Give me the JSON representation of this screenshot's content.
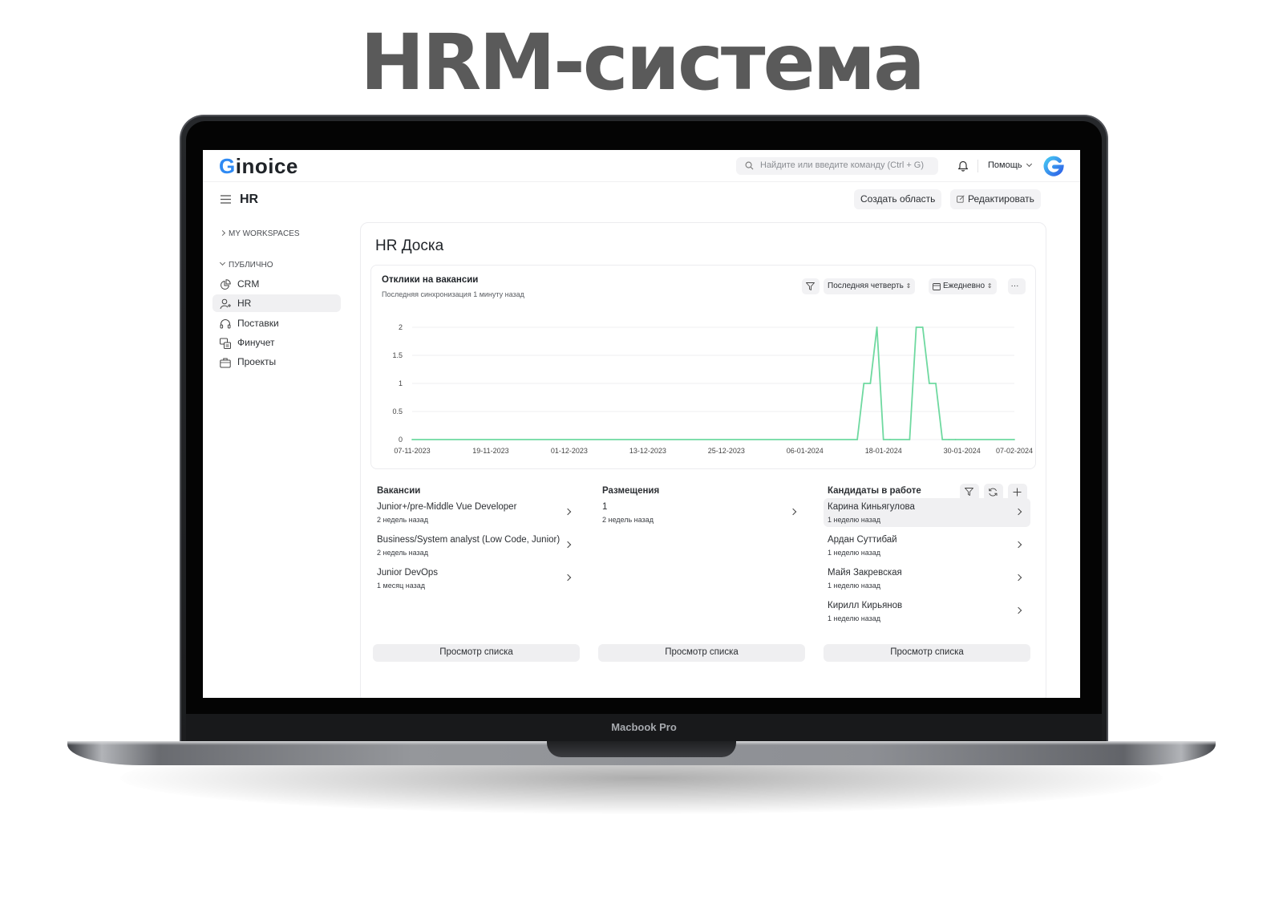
{
  "headline": "HRM-система",
  "device": {
    "brand_label": "Macbook Pro"
  },
  "app": {
    "logo_first": "G",
    "logo_rest": "inoice",
    "search_placeholder": "Найдите или введите команду (Ctrl + G)",
    "help_label": "Помощь",
    "accent_color": "#2f8af3"
  },
  "page": {
    "title": "HR",
    "create_area_label": "Создать область",
    "edit_label": "Редактировать"
  },
  "sidebar": {
    "my_workspaces": "MY WORKSPACES",
    "public_section": "ПУБЛИЧНО",
    "items": [
      {
        "label": "CRM",
        "icon": "chart-pie-icon",
        "active": false
      },
      {
        "label": "HR",
        "icon": "user-add-icon",
        "active": true
      },
      {
        "label": "Поставки",
        "icon": "headset-icon",
        "active": false
      },
      {
        "label": "Финучет",
        "icon": "money-icon",
        "active": false
      },
      {
        "label": "Проекты",
        "icon": "briefcase-icon",
        "active": false
      }
    ]
  },
  "board": {
    "title": "HR Доска",
    "chart_title": "Отклики на вакансии",
    "chart_subtitle": "Последняя синхронизация 1 минуту назад",
    "period_select": "Последняя четверть",
    "interval_select": "Ежедневно",
    "more_label": "···"
  },
  "chart_data": {
    "type": "line",
    "title": "Отклики на вакансии",
    "xlabel": "",
    "ylabel": "",
    "ylim": [
      0,
      2
    ],
    "y_ticks": [
      "0",
      "0.5",
      "1",
      "1.5",
      "2"
    ],
    "x_ticks": [
      "07-11-2023",
      "19-11-2023",
      "01-12-2023",
      "13-12-2023",
      "25-12-2023",
      "06-01-2024",
      "18-01-2024",
      "30-01-2024",
      "07-02-2024"
    ],
    "grid": true,
    "line_color": "#6fd9a0",
    "series": [
      {
        "x": [
          "07-11-2023",
          "14-01-2024",
          "15-01-2024",
          "16-01-2024",
          "17-01-2024",
          "18-01-2024",
          "19-01-2024",
          "22-01-2024",
          "23-01-2024",
          "24-01-2024",
          "25-01-2024",
          "26-01-2024",
          "27-01-2024",
          "28-01-2024",
          "29-01-2024",
          "07-02-2024"
        ],
        "y": [
          0,
          0,
          1,
          1,
          2,
          0,
          0,
          0,
          2,
          2,
          1,
          1,
          0,
          0,
          0,
          0
        ]
      }
    ]
  },
  "columns": [
    {
      "title": "Вакансии",
      "items": [
        {
          "title": "Junior+/pre-Middle Vue Developer",
          "sub": "2 недель назад"
        },
        {
          "title": "Business/System analyst (Low Code, Junior)",
          "sub": "2 недель назад"
        },
        {
          "title": "Junior DevOps",
          "sub": "1 месяц назад"
        }
      ],
      "button": "Просмотр списка"
    },
    {
      "title": "Размещения",
      "items": [
        {
          "title": "1",
          "sub": "2 недель назад"
        }
      ],
      "button": "Просмотр списка"
    },
    {
      "title": "Кандидаты в работе",
      "items": [
        {
          "title": "Карина Киньягулова",
          "sub": "1 неделю назад"
        },
        {
          "title": "Ардан Суттибай",
          "sub": "1 неделю назад"
        },
        {
          "title": "Майя Закревская",
          "sub": "1 неделю назад"
        },
        {
          "title": "Кирилл Кирьянов",
          "sub": "1 неделю назад"
        }
      ],
      "button": "Просмотр списка"
    }
  ]
}
